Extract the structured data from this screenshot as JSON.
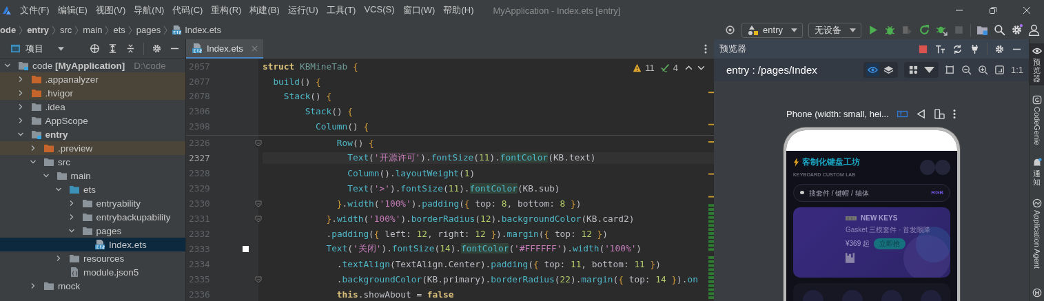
{
  "title_bar": {
    "menus": [
      "文件(F)",
      "编辑(E)",
      "视图(V)",
      "导航(N)",
      "代码(C)",
      "重构(R)",
      "构建(B)",
      "运行(U)",
      "工具(T)",
      "VCS(S)",
      "窗口(W)",
      "帮助(H)"
    ],
    "title": "MyApplication - Index.ets [entry]"
  },
  "breadcrumbs": [
    {
      "label": "ode",
      "bold": true,
      "kind": "folder"
    },
    {
      "label": "entry",
      "bold": true,
      "kind": "folder"
    },
    {
      "label": "src",
      "bold": false,
      "kind": "folder"
    },
    {
      "label": "main",
      "bold": false,
      "kind": "folder"
    },
    {
      "label": "ets",
      "bold": false,
      "kind": "folder"
    },
    {
      "label": "pages",
      "bold": false,
      "kind": "folder"
    },
    {
      "label": "Index.ets",
      "bold": false,
      "kind": "file"
    }
  ],
  "run_toolbar": {
    "module": "entry",
    "device": "无设备"
  },
  "project_panel": {
    "title": "项目",
    "tree": [
      {
        "label": "code **[MyApplication]**",
        "hint": "D:\\code",
        "kind": "module",
        "bold": false,
        "expanded": true,
        "selected": false,
        "children": [
          {
            "label": ".appanalyzer",
            "kind": "excluded",
            "bold": false,
            "expanded": false,
            "selected": false
          },
          {
            "label": ".hvigor",
            "kind": "excluded",
            "bold": false,
            "expanded": false,
            "selected": false
          },
          {
            "label": ".idea",
            "kind": "folder",
            "bold": false,
            "expanded": false,
            "selected": false
          },
          {
            "label": "AppScope",
            "kind": "folder",
            "bold": false,
            "expanded": false,
            "selected": false
          },
          {
            "label": "entry",
            "kind": "module",
            "bold": true,
            "expanded": true,
            "selected": false,
            "children": [
              {
                "label": ".preview",
                "kind": "excluded",
                "bold": false,
                "expanded": false,
                "selected": false
              },
              {
                "label": "src",
                "kind": "folder",
                "bold": false,
                "expanded": true,
                "selected": false,
                "children": [
                  {
                    "label": "main",
                    "kind": "folder",
                    "bold": false,
                    "expanded": true,
                    "selected": false,
                    "children": [
                      {
                        "label": "ets",
                        "kind": "source",
                        "bold": false,
                        "expanded": true,
                        "selected": false,
                        "children": [
                          {
                            "label": "entryability",
                            "kind": "folder",
                            "bold": false,
                            "expanded": false,
                            "selected": false
                          },
                          {
                            "label": "entrybackupability",
                            "kind": "folder",
                            "bold": false,
                            "expanded": false,
                            "selected": false
                          },
                          {
                            "label": "pages",
                            "kind": "folder",
                            "bold": false,
                            "expanded": true,
                            "selected": false,
                            "children": [
                              {
                                "label": "Index.ets",
                                "kind": "ets-file",
                                "bold": false,
                                "selected": true
                              }
                            ]
                          }
                        ]
                      },
                      {
                        "label": "resources",
                        "kind": "folder",
                        "bold": false,
                        "expanded": false,
                        "selected": false
                      },
                      {
                        "label": "module.json5",
                        "kind": "json-file",
                        "bold": false,
                        "selected": false
                      }
                    ]
                  }
                ]
              },
              {
                "label": "mock",
                "kind": "folder",
                "bold": false,
                "expanded": false,
                "selected": false
              }
            ]
          }
        ]
      }
    ]
  },
  "editor": {
    "tabs": [
      {
        "label": "Index.ets",
        "selected": true
      }
    ],
    "warnings": "11",
    "weak_warnings": "4",
    "sticky_lines": [
      {
        "number": "2057",
        "tokens": [
          {
            "kind": "kw",
            "text": "struct"
          },
          {
            "kind": "type",
            "text": " KBMineTab"
          },
          {
            "kind": "br",
            "text": " {"
          }
        ]
      },
      {
        "number": "2077",
        "tokens": [
          {
            "kind": "fn",
            "text": "  build"
          },
          {
            "kind": "p",
            "text": "()"
          },
          {
            "kind": "br",
            "text": " {"
          }
        ]
      },
      {
        "number": "2078",
        "tokens": [
          {
            "kind": "fn",
            "text": "    Stack"
          },
          {
            "kind": "p",
            "text": "()"
          },
          {
            "kind": "br",
            "text": " {"
          }
        ]
      },
      {
        "number": "2306",
        "tokens": [
          {
            "kind": "fn",
            "text": "        Stack"
          },
          {
            "kind": "p",
            "text": "()"
          },
          {
            "kind": "br",
            "text": " {"
          }
        ]
      },
      {
        "number": "2308",
        "tokens": [
          {
            "kind": "fn",
            "text": "          Column"
          },
          {
            "kind": "p",
            "text": "()"
          },
          {
            "kind": "br",
            "text": " {"
          }
        ]
      }
    ],
    "lines": [
      {
        "number": "2326",
        "current": false,
        "fold": true,
        "bookmark": false,
        "tokens": [
          {
            "kind": "fn",
            "text": "              Row"
          },
          {
            "kind": "p",
            "text": "()"
          },
          {
            "kind": "br",
            "text": " {"
          }
        ]
      },
      {
        "number": "2327",
        "current": true,
        "fold": false,
        "bookmark": false,
        "tokens": [
          {
            "kind": "fn",
            "text": "                Text"
          },
          {
            "kind": "p",
            "text": "("
          },
          {
            "kind": "str",
            "text": "'开源许可'"
          },
          {
            "kind": "p",
            "text": ")."
          },
          {
            "kind": "fn",
            "text": "fontSize"
          },
          {
            "kind": "p",
            "text": "("
          },
          {
            "kind": "num",
            "text": "11"
          },
          {
            "kind": "p",
            "text": ")."
          },
          {
            "kind": "hl",
            "text": "fontColor"
          },
          {
            "kind": "p",
            "text": "(KB.text)"
          }
        ]
      },
      {
        "number": "2328",
        "current": false,
        "fold": false,
        "bookmark": false,
        "tokens": [
          {
            "kind": "fn",
            "text": "                Column"
          },
          {
            "kind": "p",
            "text": "()."
          },
          {
            "kind": "fn",
            "text": "layoutWeight"
          },
          {
            "kind": "p",
            "text": "("
          },
          {
            "kind": "num",
            "text": "1"
          },
          {
            "kind": "p",
            "text": ")"
          }
        ]
      },
      {
        "number": "2329",
        "current": false,
        "fold": false,
        "bookmark": false,
        "tokens": [
          {
            "kind": "fn",
            "text": "                Text"
          },
          {
            "kind": "p",
            "text": "("
          },
          {
            "kind": "str",
            "text": "'>'"
          },
          {
            "kind": "p",
            "text": ")."
          },
          {
            "kind": "fn",
            "text": "fontSize"
          },
          {
            "kind": "p",
            "text": "("
          },
          {
            "kind": "num",
            "text": "11"
          },
          {
            "kind": "p",
            "text": ")."
          },
          {
            "kind": "hl",
            "text": "fontColor"
          },
          {
            "kind": "p",
            "text": "(KB.sub)"
          }
        ]
      },
      {
        "number": "2330",
        "current": false,
        "fold": true,
        "bookmark": false,
        "tokens": [
          {
            "kind": "br",
            "text": "              }"
          },
          {
            "kind": "p",
            "text": "."
          },
          {
            "kind": "fn",
            "text": "width"
          },
          {
            "kind": "p",
            "text": "("
          },
          {
            "kind": "str",
            "text": "'100%'"
          },
          {
            "kind": "p",
            "text": ")."
          },
          {
            "kind": "fn",
            "text": "padding"
          },
          {
            "kind": "p",
            "text": "("
          },
          {
            "kind": "br",
            "text": "{"
          },
          {
            "kind": "p",
            "text": " top: "
          },
          {
            "kind": "num",
            "text": "8"
          },
          {
            "kind": "p",
            "text": ", bottom: "
          },
          {
            "kind": "num",
            "text": "8"
          },
          {
            "kind": "br",
            "text": " }"
          },
          {
            "kind": "p",
            "text": ")"
          }
        ]
      },
      {
        "number": "2331",
        "current": false,
        "fold": true,
        "bookmark": false,
        "tokens": [
          {
            "kind": "br",
            "text": "            }"
          },
          {
            "kind": "p",
            "text": "."
          },
          {
            "kind": "fn",
            "text": "width"
          },
          {
            "kind": "p",
            "text": "("
          },
          {
            "kind": "str",
            "text": "'100%'"
          },
          {
            "kind": "p",
            "text": ")."
          },
          {
            "kind": "fn",
            "text": "borderRadius"
          },
          {
            "kind": "p",
            "text": "("
          },
          {
            "kind": "num",
            "text": "12"
          },
          {
            "kind": "p",
            "text": ")."
          },
          {
            "kind": "fn",
            "text": "backgroundColor"
          },
          {
            "kind": "p",
            "text": "(KB.card2)"
          }
        ]
      },
      {
        "number": "2332",
        "current": false,
        "fold": false,
        "bookmark": false,
        "tokens": [
          {
            "kind": "p",
            "text": "            ."
          },
          {
            "kind": "fn",
            "text": "padding"
          },
          {
            "kind": "p",
            "text": "("
          },
          {
            "kind": "br",
            "text": "{"
          },
          {
            "kind": "p",
            "text": " left: "
          },
          {
            "kind": "num",
            "text": "12"
          },
          {
            "kind": "p",
            "text": ", right: "
          },
          {
            "kind": "num",
            "text": "12"
          },
          {
            "kind": "br",
            "text": " }"
          },
          {
            "kind": "p",
            "text": ")."
          },
          {
            "kind": "fn",
            "text": "margin"
          },
          {
            "kind": "p",
            "text": "("
          },
          {
            "kind": "br",
            "text": "{"
          },
          {
            "kind": "p",
            "text": " top: "
          },
          {
            "kind": "num",
            "text": "12"
          },
          {
            "kind": "br",
            "text": " }"
          },
          {
            "kind": "p",
            "text": ")"
          }
        ]
      },
      {
        "number": "2333",
        "current": false,
        "fold": false,
        "bookmark": true,
        "tokens": [
          {
            "kind": "fn",
            "text": "            Text"
          },
          {
            "kind": "p",
            "text": "("
          },
          {
            "kind": "str",
            "text": "'关闭'"
          },
          {
            "kind": "p",
            "text": ")."
          },
          {
            "kind": "fn",
            "text": "fontSize"
          },
          {
            "kind": "p",
            "text": "("
          },
          {
            "kind": "num",
            "text": "14"
          },
          {
            "kind": "p",
            "text": ")."
          },
          {
            "kind": "hl",
            "text": "fontColor"
          },
          {
            "kind": "p",
            "text": "("
          },
          {
            "kind": "str",
            "text": "'#FFFFFF'"
          },
          {
            "kind": "p",
            "text": ")."
          },
          {
            "kind": "fn",
            "text": "width"
          },
          {
            "kind": "p",
            "text": "("
          },
          {
            "kind": "str",
            "text": "'100%'"
          },
          {
            "kind": "p",
            "text": ")"
          }
        ]
      },
      {
        "number": "2334",
        "current": false,
        "fold": false,
        "bookmark": false,
        "tokens": [
          {
            "kind": "p",
            "text": "              ."
          },
          {
            "kind": "fn",
            "text": "textAlign"
          },
          {
            "kind": "p",
            "text": "(TextAlign.Center)."
          },
          {
            "kind": "fn",
            "text": "padding"
          },
          {
            "kind": "p",
            "text": "("
          },
          {
            "kind": "br",
            "text": "{"
          },
          {
            "kind": "p",
            "text": " top: "
          },
          {
            "kind": "num",
            "text": "11"
          },
          {
            "kind": "p",
            "text": ", bottom: "
          },
          {
            "kind": "num",
            "text": "11"
          },
          {
            "kind": "br",
            "text": " }"
          },
          {
            "kind": "p",
            "text": ")"
          }
        ]
      },
      {
        "number": "2335",
        "current": false,
        "fold": true,
        "bookmark": false,
        "tokens": [
          {
            "kind": "p",
            "text": "              ."
          },
          {
            "kind": "fn",
            "text": "backgroundColor"
          },
          {
            "kind": "p",
            "text": "(KB.primary)."
          },
          {
            "kind": "fn",
            "text": "borderRadius"
          },
          {
            "kind": "p",
            "text": "("
          },
          {
            "kind": "num",
            "text": "22"
          },
          {
            "kind": "p",
            "text": ")."
          },
          {
            "kind": "fn",
            "text": "margin"
          },
          {
            "kind": "p",
            "text": "("
          },
          {
            "kind": "br",
            "text": "{"
          },
          {
            "kind": "p",
            "text": " top: "
          },
          {
            "kind": "num",
            "text": "14"
          },
          {
            "kind": "br",
            "text": " }"
          },
          {
            "kind": "p",
            "text": ")."
          },
          {
            "kind": "fn",
            "text": "on"
          }
        ]
      },
      {
        "number": "2336",
        "current": false,
        "fold": false,
        "bookmark": false,
        "tokens": [
          {
            "kind": "kw",
            "text": "              this"
          },
          {
            "kind": "p",
            "text": ".showAbout = "
          },
          {
            "kind": "kw",
            "text": "false"
          }
        ]
      }
    ]
  },
  "preview": {
    "title": "预览器",
    "route": "entry : /pages/Index",
    "view_modes": [
      {
        "kind": "eye",
        "selected": true
      },
      {
        "kind": "layers",
        "selected": false
      }
    ],
    "zoom_label": "1:1",
    "device": "Phone (width: small, hei...",
    "app": {
      "title": "客制化键盘工坊",
      "subtitle": "KEYBOARD CUSTOM LAB",
      "search": {
        "placeholder": "搜套件 / 键帽 / 轴体",
        "tag": "RGB"
      },
      "banner": {
        "title": "NEW KEYS",
        "subtitle": "Gasket 三模套件 · 首发限降",
        "price": "¥369 起",
        "button": "立即抢"
      }
    }
  },
  "side_tools": [
    {
      "label": "预览器",
      "kind": "eye",
      "selected": true
    },
    {
      "label": "CodeGenie",
      "kind": "genie",
      "selected": false
    },
    {
      "label": "通知",
      "kind": "bell",
      "selected": false
    },
    {
      "label": "Application Agent",
      "kind": "agent",
      "selected": false
    },
    {
      "kind": "help",
      "selected": false
    }
  ]
}
